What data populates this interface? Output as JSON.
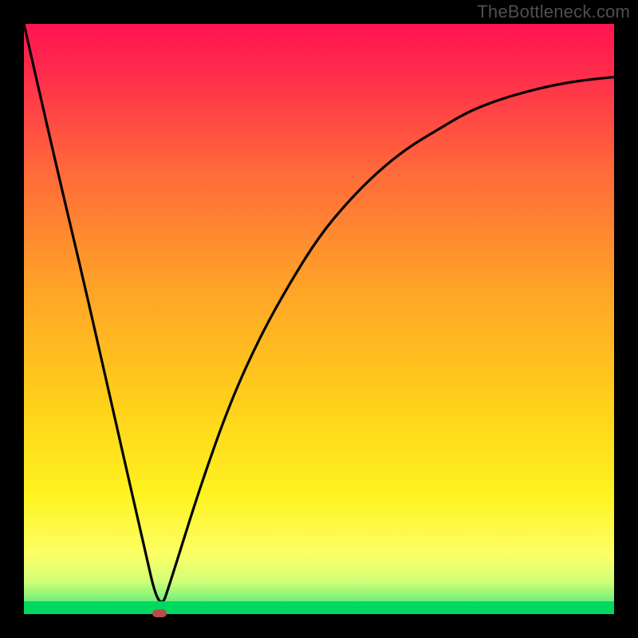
{
  "watermark": "TheBottleneck.com",
  "chart_data": {
    "type": "line",
    "title": "",
    "xlabel": "",
    "ylabel": "",
    "xlim": [
      0,
      100
    ],
    "ylim": [
      0,
      100
    ],
    "series": [
      {
        "name": "curve",
        "x": [
          0,
          5,
          10,
          15,
          20,
          23,
          25,
          30,
          35,
          40,
          45,
          50,
          55,
          60,
          65,
          70,
          75,
          80,
          85,
          90,
          95,
          100
        ],
        "y": [
          100,
          78,
          57,
          35,
          13,
          0,
          6,
          22,
          36,
          47,
          56,
          64,
          70,
          75,
          79,
          82,
          85,
          87,
          88.5,
          89.7,
          90.5,
          91
        ]
      }
    ],
    "marker": {
      "x": 23,
      "y": 0
    },
    "gradient_stops": [
      {
        "offset": 0.0,
        "color": "#ff1452"
      },
      {
        "offset": 0.08,
        "color": "#ff2b4c"
      },
      {
        "offset": 0.25,
        "color": "#ff6a3a"
      },
      {
        "offset": 0.45,
        "color": "#ffa427"
      },
      {
        "offset": 0.65,
        "color": "#ffd21a"
      },
      {
        "offset": 0.8,
        "color": "#fff321"
      },
      {
        "offset": 0.9,
        "color": "#fcff66"
      },
      {
        "offset": 0.945,
        "color": "#d0ff78"
      },
      {
        "offset": 0.975,
        "color": "#7af07a"
      },
      {
        "offset": 1.0,
        "color": "#00d960"
      }
    ]
  }
}
